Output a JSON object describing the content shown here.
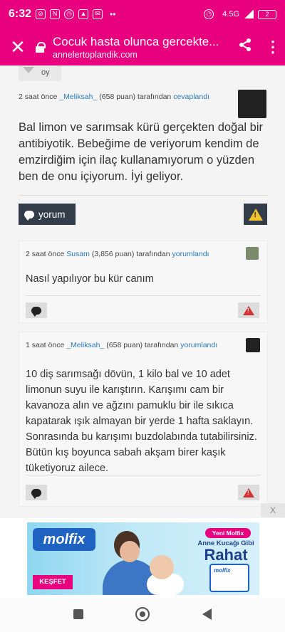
{
  "statusbar": {
    "time": "6:32",
    "network": "4.5G",
    "battery": "2"
  },
  "browser": {
    "title": "Cocuk hasta olunca gercekte...",
    "url": "annelertoplandik.com"
  },
  "answer": {
    "vote_label": "oy",
    "time": "2 saat önce",
    "author": "_Meliksah_",
    "points": "(658 puan)",
    "by": "tarafından",
    "action": "cevaplandı",
    "text": "Bal limon ve sarımsak kürü gerçekten doğal bir antibiyotik. Bebeğime de veriyorum kendim de emzirdiğim için ilaç kullanamıyorum o yüzden ben de onu içiyorum. İyi geliyor.",
    "comment_button": "yorum"
  },
  "comments": [
    {
      "time": "2 saat önce",
      "author": "Susam",
      "points": "(3,856 puan)",
      "by": "tarafından",
      "action": "yorumlandı",
      "text": "Nasıl yapılıyor bu kür canım"
    },
    {
      "time": "1 saat önce",
      "author": "_Meliksah_",
      "points": "(658 puan)",
      "by": "tarafından",
      "action": "yorumlandı",
      "text": "10 diş sarımsağı dövün, 1 kilo bal ve 10 adet limonun suyu ile karıştırın. Karışımı cam bir kavanoza alın ve ağzını pamuklu bir ile sıkıca kapatarak ışık almayan bir yerde 1 hafta saklayın. Sonrasında bu karışımı buzdolabında tutabilirsiniz. Bütün kış boyunca sabah akşam birer kaşık tüketiyoruz ailece."
    }
  ],
  "ad": {
    "close": "X",
    "brand": "molfix",
    "cta": "KEŞFET",
    "badge": "Yeni Molfix",
    "slogan_small": "Anne Kucağı Gibi",
    "slogan_big": "Rahat",
    "pack_brand": "molfix"
  }
}
